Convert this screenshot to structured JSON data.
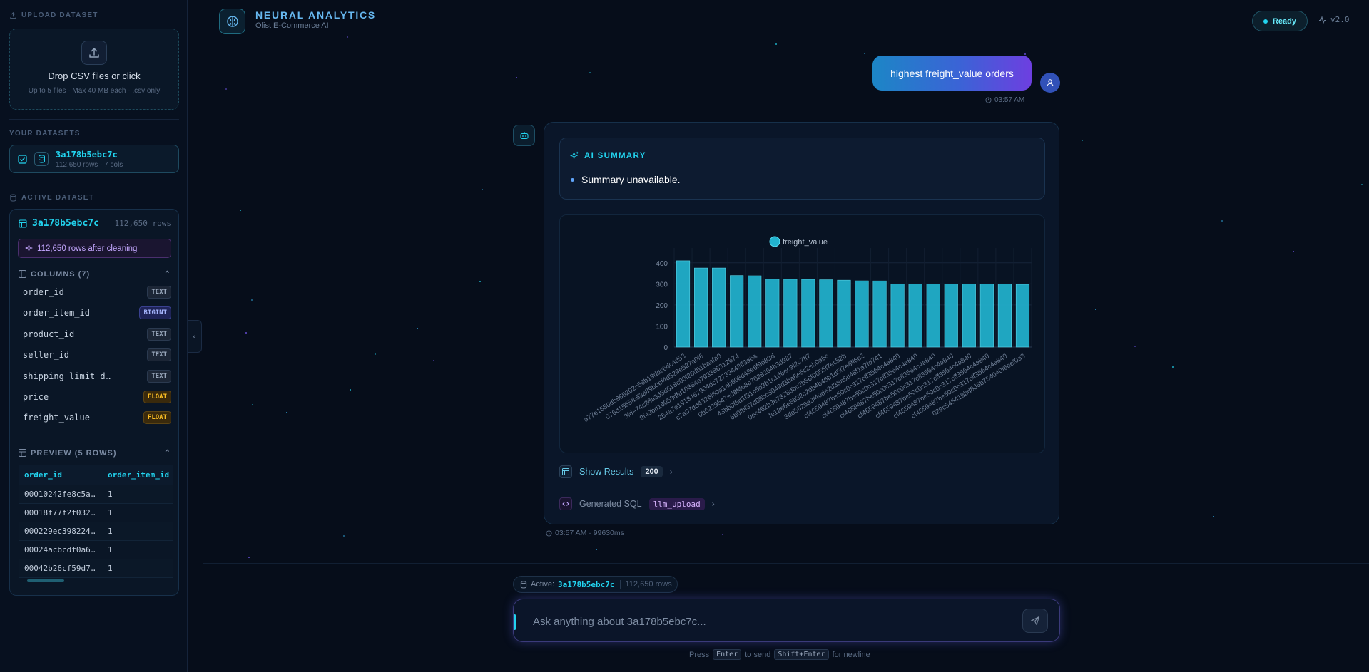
{
  "sidebar": {
    "upload_label": "UPLOAD DATASET",
    "drop_title": "Drop CSV files or click",
    "drop_sub": "Up to 5 files · Max 40 MB each · .csv only",
    "your_datasets_label": "YOUR DATASETS",
    "dataset": {
      "name": "3a178b5ebc7c",
      "meta": "112,650 rows · 7 cols"
    },
    "active_label": "ACTIVE DATASET",
    "active": {
      "name": "3a178b5ebc7c",
      "rows": "112,650 rows",
      "cleaned": "112,650 rows after cleaning",
      "columns_label": "COLUMNS (7)",
      "columns": [
        {
          "name": "order_id",
          "type": "TEXT"
        },
        {
          "name": "order_item_id",
          "type": "BIGINT"
        },
        {
          "name": "product_id",
          "type": "TEXT"
        },
        {
          "name": "seller_id",
          "type": "TEXT"
        },
        {
          "name": "shipping_limit_d…",
          "type": "TEXT"
        },
        {
          "name": "price",
          "type": "FLOAT"
        },
        {
          "name": "freight_value",
          "type": "FLOAT"
        }
      ],
      "preview_label": "PREVIEW (5 ROWS)",
      "preview_headers": [
        "order_id",
        "order_item_id"
      ],
      "preview_rows": [
        [
          "00010242fe8c5a…",
          "1"
        ],
        [
          "00018f77f2f032…",
          "1"
        ],
        [
          "000229ec398224…",
          "1"
        ],
        [
          "00024acbcdf0a6…",
          "1"
        ],
        [
          "00042b26cf59d7…",
          "1"
        ]
      ]
    }
  },
  "header": {
    "brand": "NEURAL ANALYTICS",
    "subtitle": "Olist E-Commerce AI",
    "status": "Ready",
    "version": "v2.0"
  },
  "chat": {
    "user_message": "highest freight_value orders",
    "user_time": "03:57 AM",
    "summary_title": "AI SUMMARY",
    "summary_item": "Summary unavailable.",
    "show_results_label": "Show Results",
    "results_count": "200",
    "sql_label": "Generated SQL",
    "sql_badge": "llm_upload",
    "bot_meta": "03:57 AM · 99630ms"
  },
  "chart_data": {
    "type": "bar",
    "legend": "freight_value",
    "legend_position": "top-center",
    "ylim": [
      0,
      450
    ],
    "yticks": [
      0,
      100,
      200,
      300,
      400
    ],
    "grid": true,
    "categories": [
      "a77e1550db865202c56b19ddc6dc4d53",
      "076d1555fb53a89b0ef4d529e527a0f6",
      "3fde74c28a3d5d618c00f26d51baafa0",
      "9f49bd16053df810384e793386312674",
      "264a7e1918467904dc72739448ff3a6a",
      "c7a07dd4326f60a1ab808d48e6f9d83d",
      "0b6229547ed8f4b3e7028264b3d987",
      "43bb0f5d1f31c5d3b1c1d6ec9f2c7ff7",
      "6b0fbf37d09bc5049d3ba6e5c2eb0a6c",
      "0ec462b3e7328dbc2b56f0055f7ec52b",
      "fe12e6e5b32c2db4b46b1d5f7e8ff6c2",
      "3dd5626a3f40de2d38a5d48f1a7fd741",
      "cf4659487be50c0c317cff3564c4a840",
      "cf4659487be50c0c317cff3564c4a840",
      "cf4659487be50c0c317cff3564c4a840",
      "cf4659487be50c0c317cff3564c4a840",
      "cf4659487be50c0c317cff3564c4a840",
      "cf4659487be50c0c317cff3564c4a840",
      "cf4659487be50c0c317cff3564c4a840",
      "029c545418bd8d6b754040f6eef0a3"
    ],
    "values": [
      409.68,
      375.28,
      375.28,
      339.59,
      338.3,
      322.1,
      321.88,
      321.46,
      319.47,
      317.47,
      314.4,
      314.02,
      299.16,
      299.16,
      299.16,
      299.16,
      299.16,
      299.16,
      299.16,
      297.63
    ]
  },
  "input": {
    "active_label": "Active:",
    "active_name": "3a178b5ebc7c",
    "active_rows": "112,650 rows",
    "placeholder": "Ask anything about 3a178b5ebc7c...",
    "hint_press": "Press",
    "hint_enter": "Enter",
    "hint_to_send": "to send",
    "hint_shift": "Shift+Enter",
    "hint_newline": "for newline"
  },
  "colors": {
    "accent": "#22d3ee",
    "bar": "#22b3cf",
    "user_gradient_start": "#1c86c6",
    "user_gradient_end": "#6d3fe0"
  }
}
